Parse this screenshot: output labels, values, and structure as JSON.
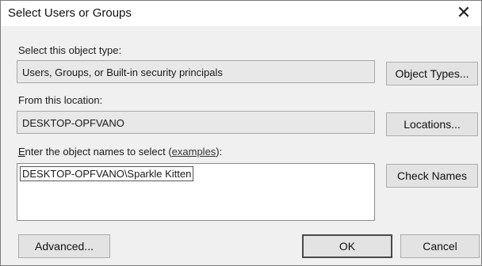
{
  "window": {
    "title": "Select Users or Groups",
    "close_glyph": "✕"
  },
  "object_type": {
    "label": "Select this object type:",
    "value": "Users, Groups, or Built-in security principals",
    "button": "Object Types..."
  },
  "location": {
    "label": "From this location:",
    "value": "DESKTOP-OPFVANO",
    "button": "Locations..."
  },
  "names": {
    "label_first": "E",
    "label_rest": "nter the object names to select (",
    "link": "examples",
    "label_end": "):",
    "value": "DESKTOP-OPFVANO\\Sparkle Kitten",
    "button": "Check Names"
  },
  "footer": {
    "advanced": "Advanced...",
    "ok": "OK",
    "cancel": "Cancel"
  }
}
